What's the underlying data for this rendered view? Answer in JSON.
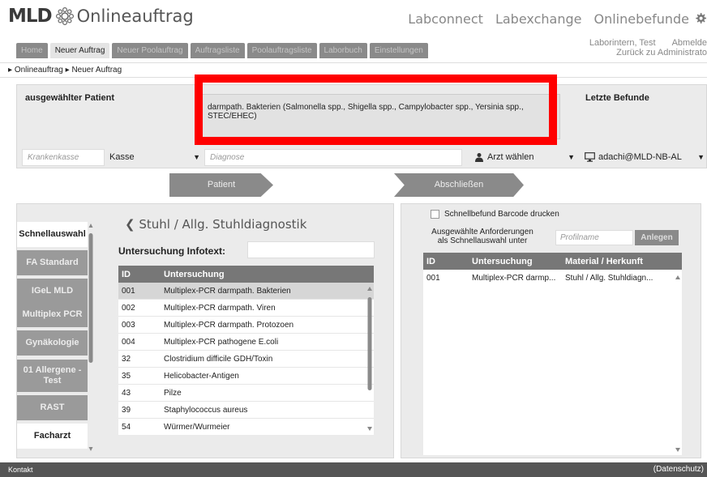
{
  "app": {
    "logo_text": "MLD",
    "name": "Onlineauftrag"
  },
  "toplinks": [
    "Labconnect",
    "Labexchange",
    "Onlinebefunde"
  ],
  "tabs": [
    "Home",
    "Neuer Auftrag",
    "Neuer Poolauftrag",
    "Auftragsliste",
    "Poolauftragsliste",
    "Laborbuch",
    "Einstellungen"
  ],
  "active_tab": "Neuer Auftrag",
  "user": {
    "name": "Laborintern, Test",
    "logout": "Abmelde",
    "back": "Zurück zu  Administrato"
  },
  "breadcrumb": [
    "Onlineauftrag",
    "Neuer Auftrag"
  ],
  "patient": {
    "title": "ausgewählter Patient",
    "diagnosis_text": "darmpath. Bakterien (Salmonella spp., Shigella spp., Campylobacter spp., Yersinia spp., STEC/EHEC)",
    "latest_results_title": "Letzte Befunde",
    "krankenkasse_placeholder": "Krankenkasse",
    "kasse_value": "Kasse",
    "diagnose_placeholder": "Diagnose",
    "arzt_value": "Arzt wählen",
    "device_value": "adachi@MLD-NB-AL"
  },
  "steps": [
    "Patient",
    "Abschließen"
  ],
  "sidebar": [
    "Schnellauswahl",
    "FA Standard",
    "IGeL MLD",
    "Multiplex PCR",
    "Gynäkologie",
    "01 Allergene - Test",
    "RAST",
    "Facharzt"
  ],
  "category_title": "Stuhl / Allg. Stuhldiagnostik",
  "infotext_label": "Untersuchung Infotext:",
  "exam_table": {
    "headers": [
      "ID",
      "Untersuchung"
    ],
    "rows": [
      [
        "001",
        "Multiplex-PCR darmpath. Bakterien"
      ],
      [
        "002",
        "Multiplex-PCR darmpath. Viren"
      ],
      [
        "003",
        "Multiplex-PCR darmpath. Protozoen"
      ],
      [
        "004",
        "Multiplex-PCR pathogene E.coli"
      ],
      [
        "32",
        "Clostridium difficile GDH/Toxin"
      ],
      [
        "35",
        "Helicobacter-Antigen"
      ],
      [
        "43",
        "Pilze"
      ],
      [
        "39",
        "Staphylococcus aureus"
      ],
      [
        "54",
        "Würmer/Wurmeier"
      ]
    ]
  },
  "right": {
    "barcode_label": "Schnellbefund Barcode drucken",
    "ausgewaehlt": "Ausgewählte Anforderungen als Schnellauswahl unter",
    "profil_placeholder": "Profilname",
    "anlegen": "Anlegen",
    "headers": [
      "ID",
      "Untersuchung",
      "Material / Herkunft"
    ],
    "rows": [
      [
        "001",
        "Multiplex-PCR darmp...",
        "Stuhl / Allg. Stuhldiagn..."
      ]
    ]
  },
  "footer": {
    "left": "Kontakt",
    "right": "(Datenschutz)"
  },
  "colors": {
    "highlight_frame": "#ff0000",
    "tab_bg": "#8a8a8a",
    "header_row": "#777777"
  }
}
